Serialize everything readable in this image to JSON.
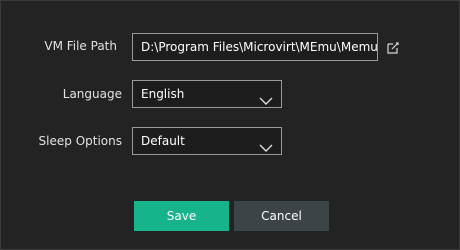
{
  "settings": {
    "vm_file_path": {
      "label": "VM File Path",
      "value": "D:\\Program Files\\Microvirt\\MEmu\\MemuHyperv VMs"
    },
    "language": {
      "label": "Language",
      "value": "English"
    },
    "sleep_options": {
      "label": "Sleep Options",
      "value": "Default"
    }
  },
  "buttons": {
    "save": "Save",
    "cancel": "Cancel"
  },
  "icons": {
    "edit": "edit-pencil-icon",
    "dropdown": "chevron-down-icon"
  },
  "colors": {
    "background": "#232323",
    "accent": "#17b48c",
    "secondary_button": "#3c4448",
    "field_border": "#9a9a9a"
  }
}
